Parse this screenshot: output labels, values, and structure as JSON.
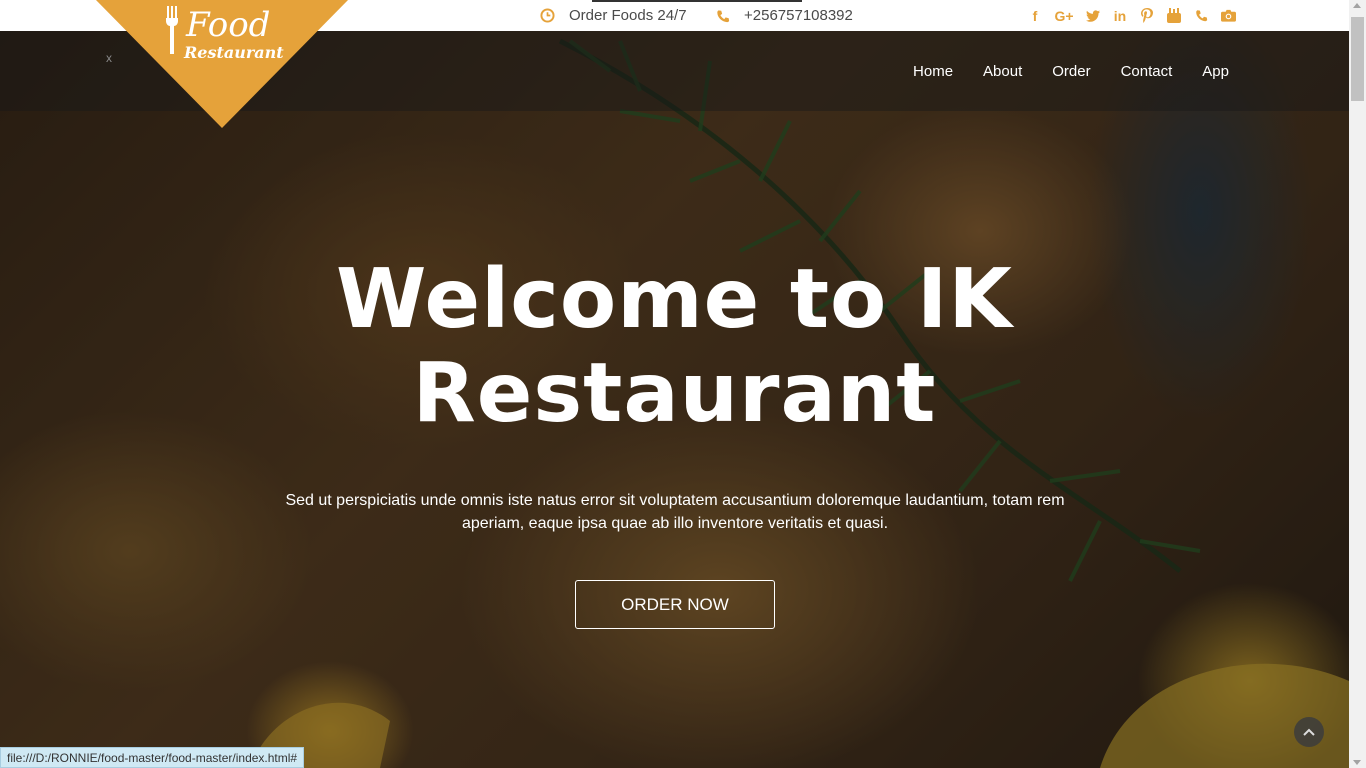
{
  "topbar": {
    "hours_text": "Order Foods 24/7",
    "phone_text": "+256757108392",
    "hours_icon": "clock-icon",
    "phone_icon": "phone-icon",
    "social_icons": [
      "facebook-icon",
      "google-plus-icon",
      "twitter-icon",
      "linkedin-icon",
      "pinterest-icon",
      "youtube-icon",
      "phone-icon",
      "camera-icon"
    ]
  },
  "logo": {
    "line1": "Food",
    "line2": "Restaurant",
    "icon": "fork-icon"
  },
  "nav": {
    "close_label": "x",
    "items": [
      "Home",
      "About",
      "Order",
      "Contact",
      "App"
    ]
  },
  "hero": {
    "headline_line1": "Welcome to IK",
    "headline_line2": "Restaurant",
    "lead": "Sed ut perspiciatis unde omnis iste natus error sit voluptatem accusantium doloremque laudantium, totam rem aperiam, eaque ipsa quae ab illo inventore veritatis et quasi.",
    "cta_label": "ORDER NOW",
    "back_to_top_icon": "chevron-up-icon"
  },
  "status_bar": {
    "url": "file:///D:/RONNIE/food-master/food-master/index.html#"
  },
  "colors": {
    "accent": "#e5a23a",
    "nav_overlay": "rgba(25,25,25,0.45)",
    "text_light": "#ffffff"
  }
}
